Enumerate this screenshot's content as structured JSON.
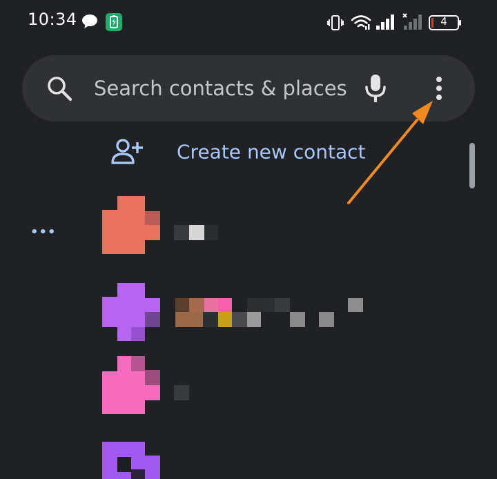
{
  "status_bar": {
    "time": "10:34",
    "battery_level": "4",
    "icons": [
      "chat-bubble-icon",
      "battery-saver-icon",
      "vibrate-icon",
      "wifi-icon",
      "signal-icon",
      "no-signal-icon",
      "battery-icon"
    ]
  },
  "search": {
    "placeholder": "Search contacts & places",
    "icons": [
      "search-icon",
      "mic-icon",
      "more-vert-icon"
    ]
  },
  "create_contact": {
    "label": "Create new contact",
    "icon": "add-person-icon"
  },
  "section": {
    "label": "•••"
  },
  "colors": {
    "background": "#202124",
    "search_bar": "#303134",
    "accent": "#a8c7fa",
    "annotation_arrow": "#f28a22",
    "avatar_1": "#e8715f",
    "avatar_2": "#b665f2",
    "avatar_3": "#f76bbf",
    "avatar_4": "#a259f0"
  }
}
